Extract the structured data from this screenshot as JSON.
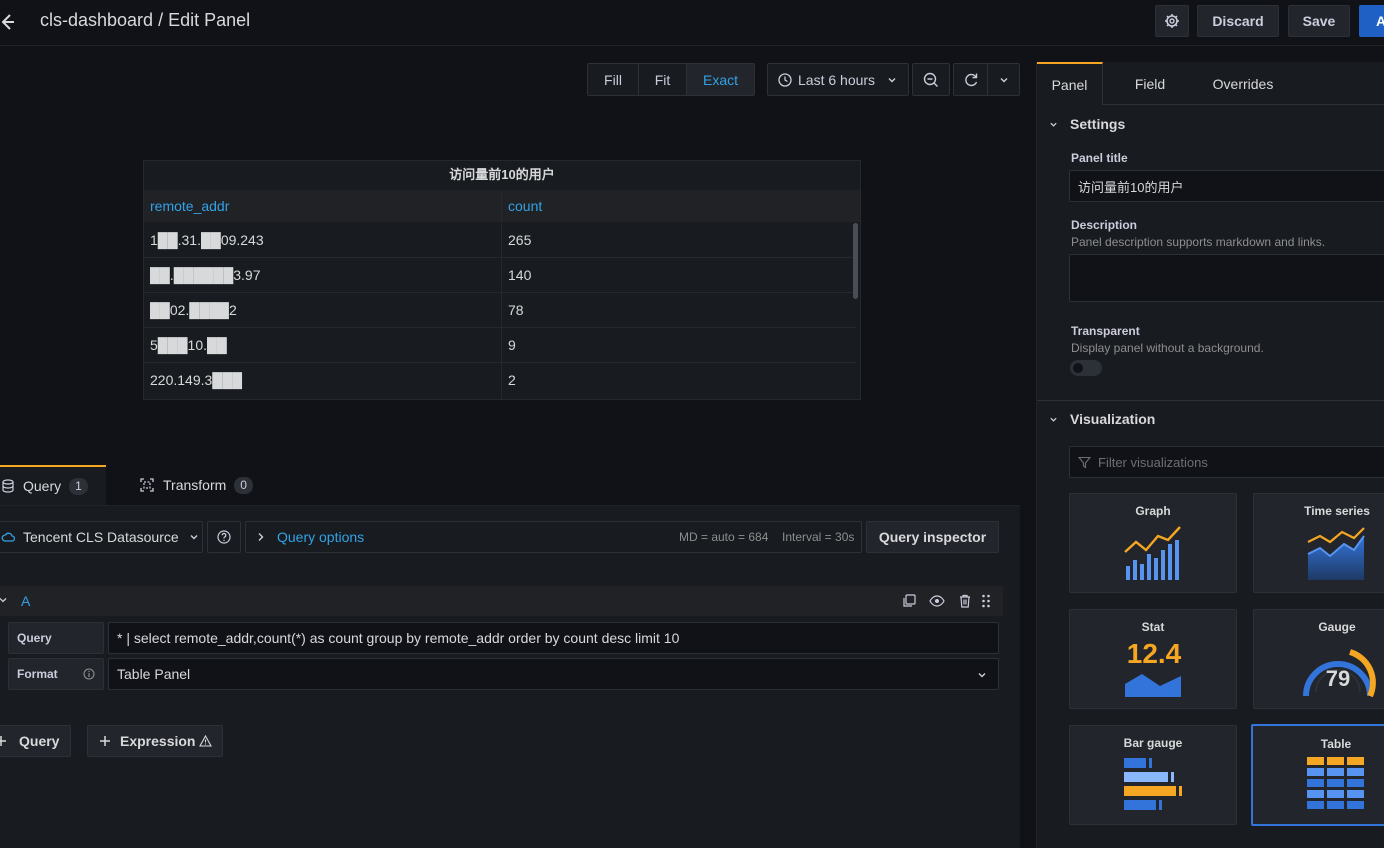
{
  "header": {
    "title": "cls-dashboard / Edit Panel",
    "discard_label": "Discard",
    "save_label": "Save",
    "apply_label": "A"
  },
  "preview_toolbar": {
    "fill_label": "Fill",
    "fit_label": "Fit",
    "exact_label": "Exact",
    "time_range": "Last 6 hours"
  },
  "table_panel": {
    "title": "访问量前10的用户",
    "columns": [
      "remote_addr",
      "count"
    ],
    "rows": [
      {
        "addr": "1██.31.██09.243",
        "count": "265"
      },
      {
        "addr": "██.██████3.97",
        "count": "140"
      },
      {
        "addr": "██02.████2",
        "count": "78"
      },
      {
        "addr": "5███10.██",
        "count": "9"
      },
      {
        "addr": "220.149.3███",
        "count": "2"
      }
    ]
  },
  "query_tabs": {
    "query_label": "Query",
    "query_count": "1",
    "transform_label": "Transform",
    "transform_count": "0"
  },
  "datasource": {
    "name": "Tencent CLS Datasource",
    "query_options_label": "Query options",
    "md_info": "MD = auto = 684",
    "interval_info": "Interval = 30s",
    "inspector_label": "Query inspector"
  },
  "query_row": {
    "ref_id": "A",
    "query_label": "Query",
    "query_value": "* | select remote_addr,count(*) as count group by remote_addr   order by count desc limit 10",
    "format_label": "Format",
    "format_value": "Table Panel"
  },
  "add_buttons": {
    "add_query_label": "Query",
    "add_expression_label": "Expression"
  },
  "options_pane": {
    "tabs": [
      "Panel",
      "Field",
      "Overrides"
    ],
    "settings_heading": "Settings",
    "panel_title_label": "Panel title",
    "panel_title_value": "访问量前10的用户",
    "description_label": "Description",
    "description_help": "Panel description supports markdown and links.",
    "transparent_label": "Transparent",
    "transparent_help": "Display panel without a background.",
    "transparent_on": false,
    "visualization_heading": "Visualization",
    "filter_placeholder": "Filter visualizations",
    "visualizations": [
      "Graph",
      "Time series",
      "Stat",
      "Gauge",
      "Bar gauge",
      "Table"
    ],
    "selected_visualization": "Table",
    "stat_value": "12.4",
    "gauge_value": "79"
  },
  "colors": {
    "accent_blue": "#33a2e5",
    "primary_button": "#1f60c4",
    "active_tab": "#f5a623",
    "selected_card": "#3274d9"
  }
}
